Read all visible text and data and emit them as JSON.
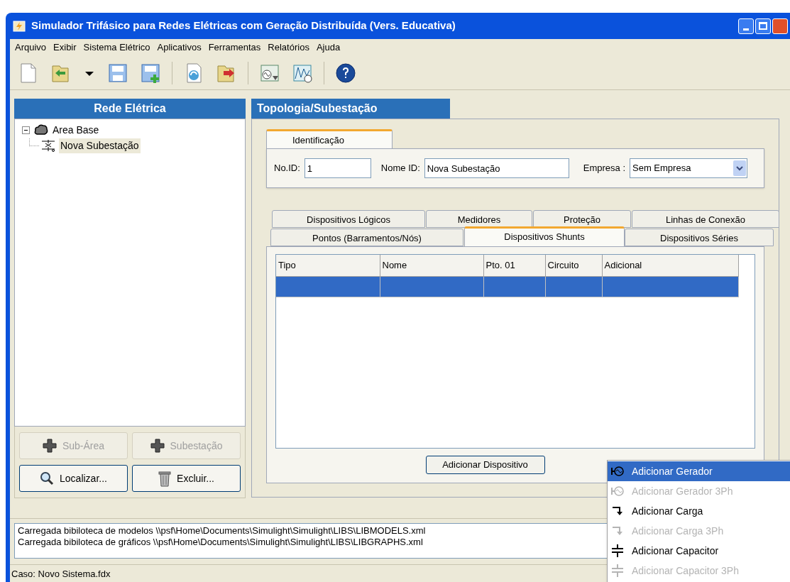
{
  "window": {
    "title": "Simulador Trifásico para Redes Elétricas com Geração Distribuída (Vers. Educativa)"
  },
  "menu": [
    "Arquivo",
    "Exibir",
    "Sistema Elétrico",
    "Aplicativos",
    "Ferramentas",
    "Relatórios",
    "Ajuda"
  ],
  "left_panel": {
    "title": "Rede Elétrica",
    "tree": [
      {
        "label": "Area Base",
        "kind": "area",
        "expanded": true,
        "selected": false,
        "children": [
          {
            "label": "Nova Subestação",
            "kind": "substation",
            "selected": true
          }
        ]
      }
    ],
    "buttons": [
      {
        "label": "Sub-Área",
        "disabled": true,
        "kind": "plus"
      },
      {
        "label": "Subestação",
        "disabled": true,
        "kind": "plus"
      },
      {
        "label": "Localizar...",
        "disabled": false,
        "kind": "search"
      },
      {
        "label": "Excluir...",
        "disabled": false,
        "kind": "trash"
      }
    ]
  },
  "right_panel": {
    "title": "Topologia/Subestação",
    "group_tab": "Identificação",
    "fields": {
      "id_label": "No.ID:",
      "id_value": "1",
      "name_label": "Nome ID:",
      "name_value": "Nova Subestação",
      "company_label": "Empresa :",
      "company_value": "Sem Empresa"
    },
    "tab_rows": [
      [
        {
          "label": "Dispositivos Lógicos",
          "selected": false
        },
        {
          "label": "Medidores",
          "selected": false
        },
        {
          "label": "Proteção",
          "selected": false
        },
        {
          "label": "Linhas de Conexão",
          "selected": false
        }
      ],
      [
        {
          "label": "Pontos (Barramentos/Nós)",
          "selected": false
        },
        {
          "label": "Dispositivos Shunts",
          "selected": true
        },
        {
          "label": "Dispositivos Séries",
          "selected": false
        }
      ]
    ],
    "table": {
      "columns": [
        "Tipo",
        "Nome",
        "Pto. 01",
        "Circuito",
        "Adicional"
      ],
      "rows": [
        {
          "selected": true
        }
      ]
    },
    "add_button": "Adicionar Dispositivo"
  },
  "popup_menu": [
    {
      "label": "Adicionar Gerador",
      "kind": "generator",
      "selected": true,
      "disabled": false
    },
    {
      "label": "Adicionar Gerador 3Ph",
      "kind": "generator",
      "selected": false,
      "disabled": true
    },
    {
      "label": "Adicionar Carga",
      "kind": "load",
      "selected": false,
      "disabled": false
    },
    {
      "label": "Adicionar Carga 3Ph",
      "kind": "load",
      "selected": false,
      "disabled": true
    },
    {
      "label": "Adicionar Capacitor",
      "kind": "capacitor",
      "selected": false,
      "disabled": false
    },
    {
      "label": "Adicionar Capacitor 3Ph",
      "kind": "capacitor",
      "selected": false,
      "disabled": true
    }
  ],
  "log": [
    "Carregada bibiloteca de modelos \\\\psf\\Home\\Documents\\Simulight\\Simulight\\LIBS\\LIBMODELS.xml",
    "Carregada bibiloteca de gráficos \\\\psf\\Home\\Documents\\Simulight\\Simulight\\LIBS\\LIBGRAPHS.xml"
  ],
  "status_bar": "Caso: Novo Sistema.fdx"
}
